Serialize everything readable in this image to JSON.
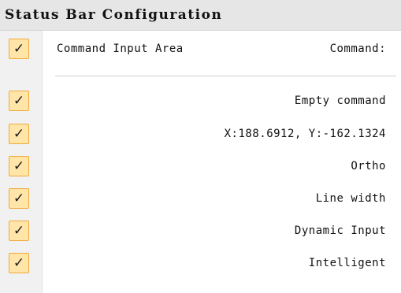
{
  "menu": {
    "title": "Status Bar Configuration",
    "check_glyph": "✓",
    "first_item": {
      "label": "Command Input Area",
      "value": "Command:"
    },
    "items": [
      {
        "label": "Empty command"
      },
      {
        "label": "X:188.6912, Y:-162.1324"
      },
      {
        "label": "Ortho"
      },
      {
        "label": "Line width"
      },
      {
        "label": "Dynamic Input"
      },
      {
        "label": "Intelligent"
      }
    ]
  },
  "colors": {
    "check_fill": "#ffe5a8",
    "check_border": "#f2a93b",
    "header_bg": "#e6e6e6",
    "gutter_bg": "#f1f1f1"
  }
}
